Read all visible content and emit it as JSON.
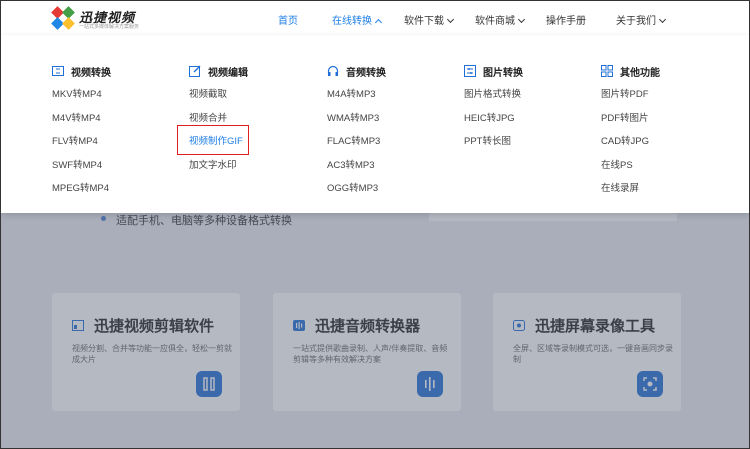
{
  "header": {
    "brand": "迅捷视频",
    "brand_sub": "一站式多媒体解决方案服务",
    "nav": [
      {
        "label": "首页",
        "active": true,
        "caret": null
      },
      {
        "label": "在线转换",
        "active": true,
        "caret": "up"
      },
      {
        "label": "软件下载",
        "active": false,
        "caret": "down"
      },
      {
        "label": "软件商城",
        "active": false,
        "caret": "down"
      },
      {
        "label": "操作手册",
        "active": false,
        "caret": null
      },
      {
        "label": "关于我们",
        "active": false,
        "caret": "down"
      }
    ]
  },
  "dropdown": {
    "columns": [
      {
        "title": "视频转换",
        "icon": "video-convert-icon",
        "items": [
          "MKV转MP4",
          "M4V转MP4",
          "FLV转MP4",
          "SWF转MP4",
          "MPEG转MP4"
        ]
      },
      {
        "title": "视频编辑",
        "icon": "video-edit-icon",
        "items": [
          "视频截取",
          "视频合并",
          "视频制作GIF",
          "加文字水印"
        ]
      },
      {
        "title": "音频转换",
        "icon": "headphones-icon",
        "items": [
          "M4A转MP3",
          "WMA转MP3",
          "FLAC转MP3",
          "AC3转MP3",
          "OGG转MP3"
        ]
      },
      {
        "title": "图片转换",
        "icon": "image-convert-icon",
        "items": [
          "图片格式转换",
          "HEIC转JPG",
          "PPT转长图"
        ]
      },
      {
        "title": "其他功能",
        "icon": "grid-icon",
        "items": [
          "图片转PDF",
          "PDF转图片",
          "CAD转JPG",
          "在线PS",
          "在线录屏"
        ]
      }
    ],
    "highlighted_item": "视频制作GIF"
  },
  "background": {
    "bullet_text": "适配手机、电脑等多种设备格式转换",
    "cards": [
      {
        "title": "迅捷视频剪辑软件",
        "desc": "视频分割、合并等功能一应俱全，轻松一剪就成大片",
        "icon": "video-editor-icon"
      },
      {
        "title": "迅捷音频转换器",
        "desc": "一站式提供歌曲录制、人声/伴奏提取、音频剪辑等多种有效解决方案",
        "icon": "audio-wave-icon"
      },
      {
        "title": "迅捷屏幕录像工具",
        "desc": "全屏、区域等录制模式可选，一键音画同步录制",
        "icon": "screen-record-icon"
      }
    ]
  },
  "colors": {
    "accent": "#1f7fe5",
    "highlight_border": "#e02020"
  }
}
